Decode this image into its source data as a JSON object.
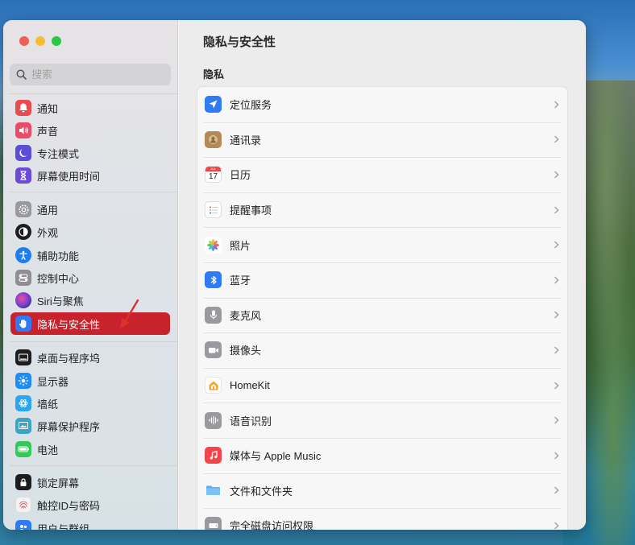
{
  "window": {
    "title": "隐私与安全性"
  },
  "search": {
    "placeholder": "搜索"
  },
  "sidebar": {
    "items": [
      {
        "label": "通知",
        "icon": "bell-icon",
        "color": "#e94b50"
      },
      {
        "label": "声音",
        "icon": "speaker-icon",
        "color": "#e94b68"
      },
      {
        "label": "专注模式",
        "icon": "moon-icon",
        "color": "#5c4fd6"
      },
      {
        "label": "屏幕使用时间",
        "icon": "hourglass-icon",
        "color": "#6c49d6"
      },
      {
        "label": "通用",
        "icon": "gear-icon",
        "color": "#9a9a9e"
      },
      {
        "label": "外观",
        "icon": "appearance-icon",
        "color": "#1d1d1f"
      },
      {
        "label": "辅助功能",
        "icon": "accessibility-icon",
        "color": "#1e7bf2"
      },
      {
        "label": "控制中心",
        "icon": "control-center-icon",
        "color": "#8e8e93"
      },
      {
        "label": "Siri与聚焦",
        "icon": "siri-icon",
        "color": "#6a3ed4"
      },
      {
        "label": "隐私与安全性",
        "icon": "hand-icon",
        "color": "#2f7bf5"
      },
      {
        "label": "桌面与程序坞",
        "icon": "dock-icon",
        "color": "#1d1d1f"
      },
      {
        "label": "显示器",
        "icon": "sun-icon",
        "color": "#1f8bf5"
      },
      {
        "label": "墙纸",
        "icon": "wallpaper-icon",
        "color": "#28a6f0"
      },
      {
        "label": "屏幕保护程序",
        "icon": "screensaver-icon",
        "color": "#3aa4c8"
      },
      {
        "label": "电池",
        "icon": "battery-icon",
        "color": "#34c759"
      },
      {
        "label": "锁定屏幕",
        "icon": "lock-icon",
        "color": "#1d1d1f"
      },
      {
        "label": "触控ID与密码",
        "icon": "fingerprint-icon",
        "color": "#f2f2f2"
      },
      {
        "label": "用户与群组",
        "icon": "users-icon",
        "color": "#2f7bf5"
      }
    ]
  },
  "main": {
    "title": "隐私与安全性",
    "section": "隐私",
    "rows": [
      {
        "label": "定位服务",
        "icon": "location-arrow-icon",
        "color": "#2f7bf5"
      },
      {
        "label": "通讯录",
        "icon": "contacts-icon",
        "color": "#b38a56"
      },
      {
        "label": "日历",
        "icon": "calendar-icon",
        "color": "#ffffff",
        "day": "17",
        "month": "JUL"
      },
      {
        "label": "提醒事项",
        "icon": "reminders-icon",
        "color": "#ffffff"
      },
      {
        "label": "照片",
        "icon": "photos-icon",
        "color": "#ffffff"
      },
      {
        "label": "蓝牙",
        "icon": "bluetooth-icon",
        "color": "#2f7bf5"
      },
      {
        "label": "麦克风",
        "icon": "microphone-icon",
        "color": "#9a9a9e"
      },
      {
        "label": "摄像头",
        "icon": "camera-icon",
        "color": "#9a9a9e"
      },
      {
        "label": "HomeKit",
        "icon": "homekit-icon",
        "color": "#ffffff"
      },
      {
        "label": "语音识别",
        "icon": "speech-recognition-icon",
        "color": "#9a9a9e"
      },
      {
        "label": "媒体与 Apple Music",
        "icon": "music-icon",
        "color": "#f2454b"
      },
      {
        "label": "文件和文件夹",
        "icon": "folder-icon",
        "color": "#5ab0f0"
      },
      {
        "label": "完全磁盘访问权限",
        "icon": "disk-icon",
        "color": "#9a9a9e"
      }
    ]
  },
  "colors": {
    "accent": "#c8232c",
    "annotation_arrow": "#e0302b"
  }
}
